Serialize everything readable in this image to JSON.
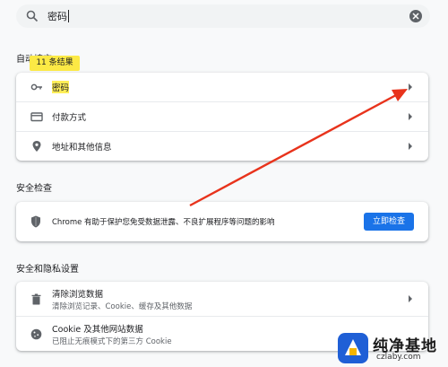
{
  "search": {
    "value": "密码"
  },
  "autofill": {
    "section_title": "自动填充",
    "badge": "11 条结果",
    "items": [
      {
        "label": "密码",
        "icon": "key-icon"
      },
      {
        "label": "付款方式",
        "icon": "credit-card-icon"
      },
      {
        "label": "地址和其他信息",
        "icon": "location-pin-icon"
      }
    ]
  },
  "safety": {
    "section_title": "安全检查",
    "message": "Chrome 有助于保护您免受数据泄露、不良扩展程序等问题的影响",
    "button": "立即检查",
    "icon": "shield-icon"
  },
  "privacy": {
    "section_title": "安全和隐私设置",
    "items": [
      {
        "title": "清除浏览数据",
        "subtitle": "清除浏览记录、Cookie、缓存及其他数据",
        "icon": "trash-icon"
      },
      {
        "title": "Cookie 及其他网站数据",
        "subtitle": "已阻止无痕模式下的第三方 Cookie",
        "icon": "cookie-icon"
      }
    ]
  },
  "watermark": {
    "title": "纯净基地",
    "url": "czlaby.com"
  },
  "colors": {
    "accent": "#1a73e8",
    "highlight": "#ffee58",
    "annotation_arrow": "#e8331c"
  }
}
